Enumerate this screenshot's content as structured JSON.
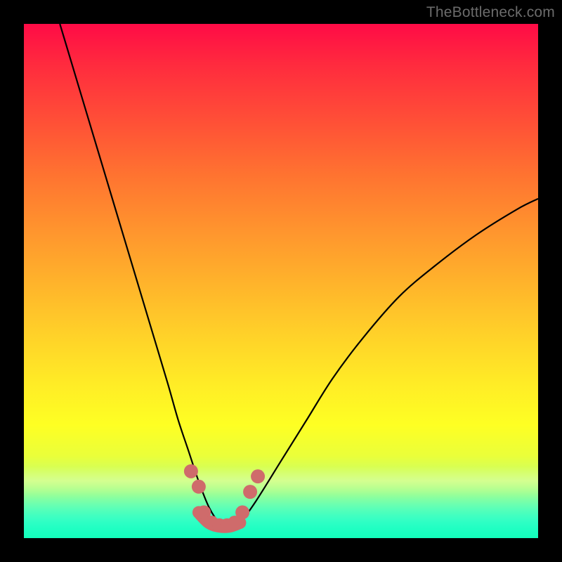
{
  "watermark": "TheBottleneck.com",
  "colors": {
    "frame": "#000000",
    "curve": "#000000",
    "marker": "#cf6b6b",
    "gradient_top": "#ff0b46",
    "gradient_bottom": "#00ffff"
  },
  "chart_data": {
    "type": "line",
    "title": "",
    "xlabel": "",
    "ylabel": "",
    "xlim": [
      0,
      100
    ],
    "ylim": [
      0,
      100
    ],
    "series": [
      {
        "name": "bottleneck-curve",
        "x": [
          7,
          10,
          13,
          16,
          19,
          22,
          25,
          28,
          30,
          32,
          34,
          36,
          38,
          40,
          42,
          45,
          50,
          55,
          60,
          66,
          73,
          80,
          88,
          96,
          100
        ],
        "y": [
          100,
          90,
          80,
          70,
          60,
          50,
          40,
          30,
          23,
          17,
          11,
          6,
          3,
          2,
          3,
          7,
          15,
          23,
          31,
          39,
          47,
          53,
          59,
          64,
          66
        ]
      }
    ],
    "valley_markers": {
      "x": [
        32.5,
        34.0,
        35.0,
        36.5,
        38.0,
        39.5,
        41.0,
        42.5,
        44.0,
        45.5
      ],
      "y": [
        13.0,
        10.0,
        5.0,
        3.0,
        2.5,
        2.5,
        3.0,
        5.0,
        9.0,
        12.0
      ],
      "radius": 10
    },
    "thick_segment": {
      "x": [
        34.0,
        36.0,
        38.0,
        40.0,
        42.0
      ],
      "y": [
        5.0,
        3.0,
        2.3,
        2.3,
        3.0
      ]
    }
  }
}
